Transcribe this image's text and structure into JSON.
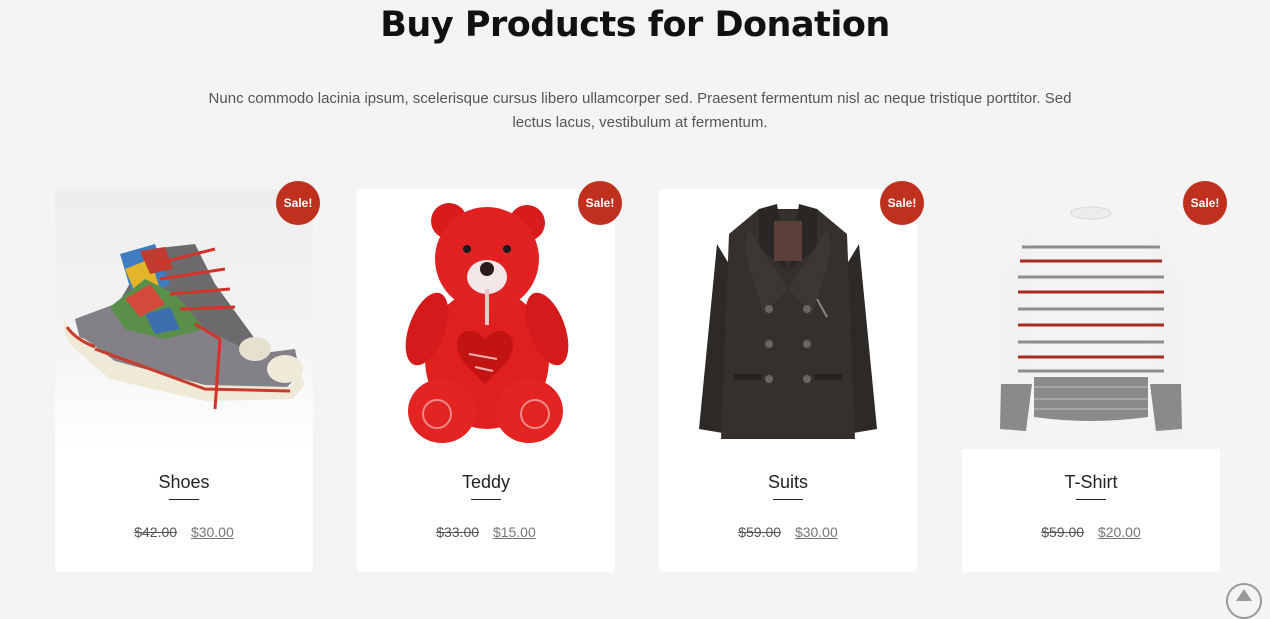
{
  "section": {
    "title": "Buy Products for Donation",
    "description": "Nunc commodo lacinia ipsum, scelerisque cursus libero ullamcorper sed. Praesent fermentum nisl ac neque tristique porttitor. Sed lectus lacus, vestibulum at fermentum."
  },
  "colors": {
    "background": "#f4f4f4",
    "sale_badge": "#c0301e",
    "card": "#ffffff"
  },
  "products": [
    {
      "name": "Shoes",
      "badge": "Sale!",
      "old_price": "$42.00",
      "new_price": "$30.00",
      "image": "sneakers-image"
    },
    {
      "name": "Teddy",
      "badge": "Sale!",
      "old_price": "$33.00",
      "new_price": "$15.00",
      "image": "teddy-bear-image"
    },
    {
      "name": "Suits",
      "badge": "Sale!",
      "old_price": "$59.00",
      "new_price": "$30.00",
      "image": "coat-image"
    },
    {
      "name": "T-Shirt",
      "badge": "Sale!",
      "old_price": "$59.00",
      "new_price": "$20.00",
      "image": "striped-sweater-image"
    }
  ],
  "scroll_top": {
    "icon": "arrow-up-icon"
  }
}
